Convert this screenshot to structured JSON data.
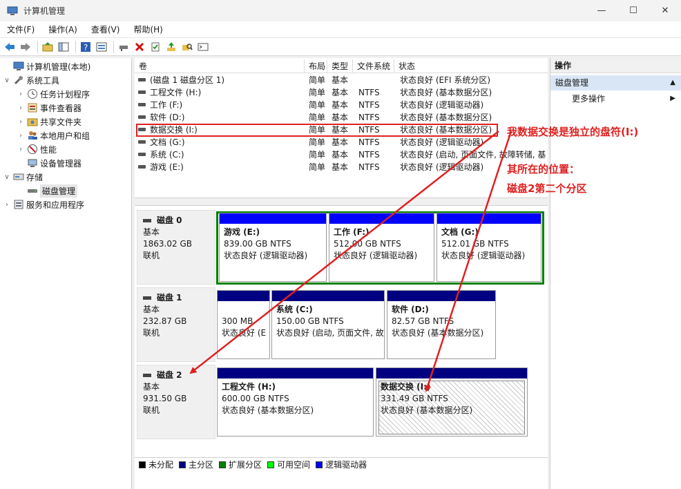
{
  "window": {
    "title": "计算机管理",
    "controls": [
      "—",
      "☐",
      "✕"
    ]
  },
  "menu": [
    "文件(F)",
    "操作(A)",
    "查看(V)",
    "帮助(H)"
  ],
  "tree": [
    {
      "label": "计算机管理(本地)",
      "level": 0,
      "exp": ""
    },
    {
      "label": "系统工具",
      "level": 1,
      "exp": "∨"
    },
    {
      "label": "任务计划程序",
      "level": 2,
      "exp": "›"
    },
    {
      "label": "事件查看器",
      "level": 2,
      "exp": "›"
    },
    {
      "label": "共享文件夹",
      "level": 2,
      "exp": "›"
    },
    {
      "label": "本地用户和组",
      "level": 2,
      "exp": "›"
    },
    {
      "label": "性能",
      "level": 2,
      "exp": "›"
    },
    {
      "label": "设备管理器",
      "level": 2,
      "exp": ""
    },
    {
      "label": "存储",
      "level": 1,
      "exp": "∨"
    },
    {
      "label": "磁盘管理",
      "level": 2,
      "exp": "",
      "selected": true
    },
    {
      "label": "服务和应用程序",
      "level": 1,
      "exp": "›"
    }
  ],
  "volumes": {
    "headers": [
      "卷",
      "布局",
      "类型",
      "文件系统",
      "状态"
    ],
    "rows": [
      [
        "(磁盘 1 磁盘分区 1)",
        "简单",
        "基本",
        "",
        "状态良好 (EFI 系统分区)"
      ],
      [
        "工程文件 (H:)",
        "简单",
        "基本",
        "NTFS",
        "状态良好 (基本数据分区)"
      ],
      [
        "工作 (F:)",
        "简单",
        "基本",
        "NTFS",
        "状态良好 (逻辑驱动器)"
      ],
      [
        "软件 (D:)",
        "简单",
        "基本",
        "NTFS",
        "状态良好 (基本数据分区)"
      ],
      [
        "数据交换 (I:)",
        "简单",
        "基本",
        "NTFS",
        "状态良好 (基本数据分区)"
      ],
      [
        "文档 (G:)",
        "简单",
        "基本",
        "NTFS",
        "状态良好 (逻辑驱动器)"
      ],
      [
        "系统 (C:)",
        "简单",
        "基本",
        "NTFS",
        "状态良好 (启动, 页面文件, 故障转储, 基"
      ],
      [
        "游戏 (E:)",
        "简单",
        "基本",
        "NTFS",
        "状态良好 (逻辑驱动器)"
      ]
    ]
  },
  "disks": [
    {
      "name": "磁盘 0",
      "type": "基本",
      "size": "1863.02 GB",
      "status": "联机",
      "partitions": [
        {
          "name": "游戏  (E:)",
          "size": "839.00 GB NTFS",
          "status": "状态良好 (逻辑驱动器)"
        },
        {
          "name": "工作  (F:)",
          "size": "512.00 GB NTFS",
          "status": "状态良好 (逻辑驱动器)"
        },
        {
          "name": "文档  (G:)",
          "size": "512.01 GB NTFS",
          "status": "状态良好 (逻辑驱动器)"
        }
      ]
    },
    {
      "name": "磁盘 1",
      "type": "基本",
      "size": "232.87 GB",
      "status": "联机",
      "partitions": [
        {
          "name": "",
          "size": "300 MB",
          "status": "状态良好 (E"
        },
        {
          "name": "系统  (C:)",
          "size": "150.00 GB NTFS",
          "status": "状态良好 (启动, 页面文件, 故"
        },
        {
          "name": "软件  (D:)",
          "size": "82.57 GB NTFS",
          "status": "状态良好 (基本数据分区)"
        }
      ]
    },
    {
      "name": "磁盘 2",
      "type": "基本",
      "size": "931.50 GB",
      "status": "联机",
      "partitions": [
        {
          "name": "工程文件  (H:)",
          "size": "600.00 GB NTFS",
          "status": "状态良好 (基本数据分区)"
        },
        {
          "name": "数据交换  (I:)",
          "size": "331.49 GB NTFS",
          "status": "状态良好 (基本数据分区)"
        }
      ]
    }
  ],
  "legend": [
    {
      "label": "未分配",
      "color": "#000000"
    },
    {
      "label": "主分区",
      "color": "#000080"
    },
    {
      "label": "扩展分区",
      "color": "#008000"
    },
    {
      "label": "可用空间",
      "color": "#00ff00"
    },
    {
      "label": "逻辑驱动器",
      "color": "#0000ff"
    }
  ],
  "actions": {
    "header": "操作",
    "section": "磁盘管理",
    "more": "更多操作"
  },
  "annotations": {
    "line1": "我数据交换是独立的盘符(I:)",
    "line2": "其所在的位置：",
    "line3": "磁盘2第二个分区"
  },
  "colors": {
    "primary_bar": "#000080",
    "logical_bar": "#0000ff",
    "extended_border": "#008000",
    "annotation": "#e02020"
  }
}
